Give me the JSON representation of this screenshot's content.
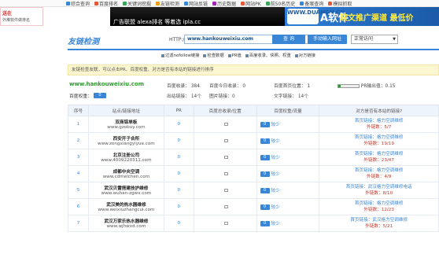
{
  "topnav": {
    "items": [
      {
        "label": "综合查询",
        "color": "#3a86d6"
      },
      {
        "label": "百度排名",
        "color": "#e25c3c"
      },
      {
        "label": "关键词挖掘",
        "color": "#3ba55c"
      },
      {
        "label": "友链检测",
        "color": "#f0a020"
      },
      {
        "label": "网站反链",
        "color": "#3a86d6"
      },
      {
        "label": "历史数据",
        "color": "#9c27b0"
      },
      {
        "label": "网站PK",
        "color": "#e25c3c"
      },
      {
        "label": "前50名历史",
        "color": "#3ba55c"
      },
      {
        "label": "备案查询",
        "color": "#3a86d6"
      },
      {
        "label": "模拟抓取",
        "color": "#e25c3c"
      }
    ]
  },
  "ads": {
    "ad0_title": "送在",
    "ad0_sub": "外推软件做排名",
    "ad1_title": "",
    "ad2_title": "广告联盟 alexa排名 等着选 ipla.cc",
    "ad3_logo": "WWW.DUAMEN.CN",
    "ad3_badge": "A软件",
    "ad3_text": "软文推广渠道 最低价"
  },
  "toolbar": {
    "brand": "友链检测",
    "http_label": "HTTP://",
    "url_value": "www.hankouweixiu.com",
    "query_btn": "查 询",
    "manual_btn": "手动输入网址",
    "select_value": "正常访问"
  },
  "options": [
    "过滤nofollow链接",
    "检查数据",
    "PR值",
    "百度收录、快照、权重",
    "对方链接"
  ],
  "tip": "友链检查友联，可以点击PR、百度权重、对方是否有本站的链接进行排序",
  "summary": {
    "domain": "www.hankouweixiu.com",
    "baidu_index": "百度收录： 384",
    "baidu_today": "百度今日收录： 0",
    "baidu_home": "百度首页位置： 1",
    "pr_label": "PR输出值：0.15",
    "baidu_weight_label": "百度权重：",
    "baidu_weight_value": "0",
    "outlinks": "出站链接： 14个",
    "img_links": "图片链接：0",
    "text_links": "文字链接： 14个"
  },
  "table": {
    "headers": [
      "序号",
      "站点/链接地址",
      "PR",
      "百度总收录/位置",
      "百度权重/流量",
      "对方是否有本站的链接?"
    ],
    "rows": [
      {
        "idx": "1",
        "name": "双商铝单板",
        "url": "www.gzobuy.com",
        "pr": "0",
        "flow": "较少",
        "a1": "首页链接：格力空调维修",
        "a2": "外链数：5/7"
      },
      {
        "idx": "2",
        "name": "西安开子合所",
        "url": "www.zongxiangyiyue.com",
        "pr": "0",
        "flow": "较少",
        "a1": "首页链接：格力空调维修",
        "a2": "外链数：19/19"
      },
      {
        "idx": "3",
        "name": "北京注册公司",
        "url": "www.4009220311.com",
        "pr": "0",
        "flow": "较少",
        "a1": "首页链接：格力空调维修",
        "a2": "外链数：23/47"
      },
      {
        "idx": "4",
        "name": "成都中央空调",
        "url": "www.cdmelchen.com",
        "pr": "0",
        "flow": "较少",
        "a1": "首页链接：格力空调维修",
        "a2": "外链数：4/9"
      },
      {
        "idx": "5",
        "name": "武汉贝雷搭建技护维修",
        "url": "www.wuhan-zgwx.com",
        "pr": "0",
        "flow": "较少",
        "a1": "首页链接：武汉格力空调维修电话",
        "a2": "外链数：8/10"
      },
      {
        "idx": "6",
        "name": "武汉美的热水器维修",
        "url": "www.weixiuzhangcui.com",
        "pr": "0",
        "flow": "较少",
        "a1": "首页链接：格力空调维修",
        "a2": "外链数：12/23"
      },
      {
        "idx": "7",
        "name": "武汉万家乐热水器维修",
        "url": "www.wjhwxd.com",
        "pr": "0",
        "flow": "较少",
        "a1": "首页链接：武汉格力空调维修",
        "a2": "外链数：5/21"
      }
    ]
  }
}
